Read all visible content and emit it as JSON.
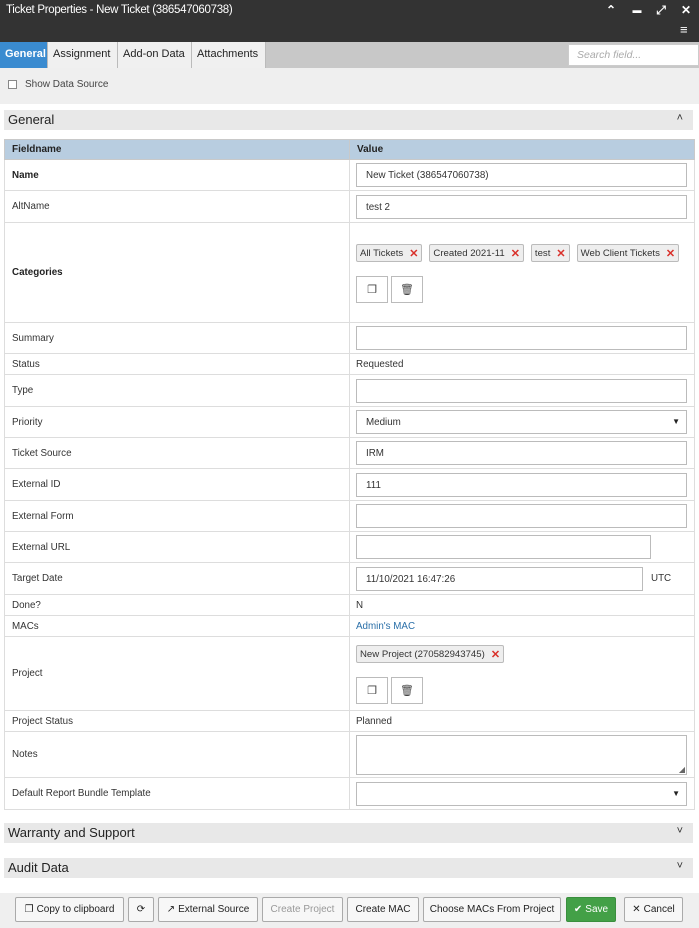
{
  "window": {
    "title": "Ticket Properties - New Ticket (386547060738)",
    "controls": {
      "collapse": "⌃",
      "minimize": "▬",
      "maximize": "⤢",
      "close": "✕",
      "menu": "≡"
    }
  },
  "tabs": [
    {
      "label": "General",
      "active": true
    },
    {
      "label": "Assignment",
      "active": false
    },
    {
      "label": "Add-on Data",
      "active": false
    },
    {
      "label": "Attachments",
      "active": false
    }
  ],
  "search": {
    "placeholder": "Search field..."
  },
  "show_data_source": {
    "label": "Show Data Source",
    "checked": false
  },
  "sections": {
    "general": "General",
    "warranty": "Warranty and Support",
    "audit": "Audit Data"
  },
  "table": {
    "headers": {
      "field": "Fieldname",
      "value": "Value"
    },
    "name": {
      "label": "Name",
      "value": "New Ticket (386547060738)"
    },
    "altname": {
      "label": "AltName",
      "value": "test 2"
    },
    "categories": {
      "label": "Categories",
      "chips": [
        "All Tickets",
        "Created 2021-11",
        "test",
        "Web Client Tickets"
      ]
    },
    "summary": {
      "label": "Summary",
      "value": ""
    },
    "status": {
      "label": "Status",
      "value": "Requested"
    },
    "type": {
      "label": "Type",
      "value": ""
    },
    "priority": {
      "label": "Priority",
      "value": "Medium"
    },
    "ticket_source": {
      "label": "Ticket Source",
      "value": "IRM"
    },
    "external_id": {
      "label": "External ID",
      "value": "111"
    },
    "external_form": {
      "label": "External Form",
      "value": ""
    },
    "external_url": {
      "label": "External URL",
      "value": ""
    },
    "target_date": {
      "label": "Target Date",
      "value": "11/10/2021 16:47:26",
      "tz": "UTC"
    },
    "done": {
      "label": "Done?",
      "value": "N"
    },
    "macs": {
      "label": "MACs",
      "value": "Admin's MAC"
    },
    "project": {
      "label": "Project",
      "chip": "New Project (270582943745)"
    },
    "project_status": {
      "label": "Project Status",
      "value": "Planned"
    },
    "notes": {
      "label": "Notes",
      "value": ""
    },
    "report_bundle": {
      "label": "Default Report Bundle Template",
      "value": ""
    }
  },
  "footer": {
    "copy": "Copy to clipboard",
    "refresh": "⟳",
    "external_source": "External Source",
    "create_project": "Create Project",
    "create_mac": "Create MAC",
    "choose_macs": "Choose MACs From Project",
    "save": "Save",
    "cancel": "Cancel"
  }
}
